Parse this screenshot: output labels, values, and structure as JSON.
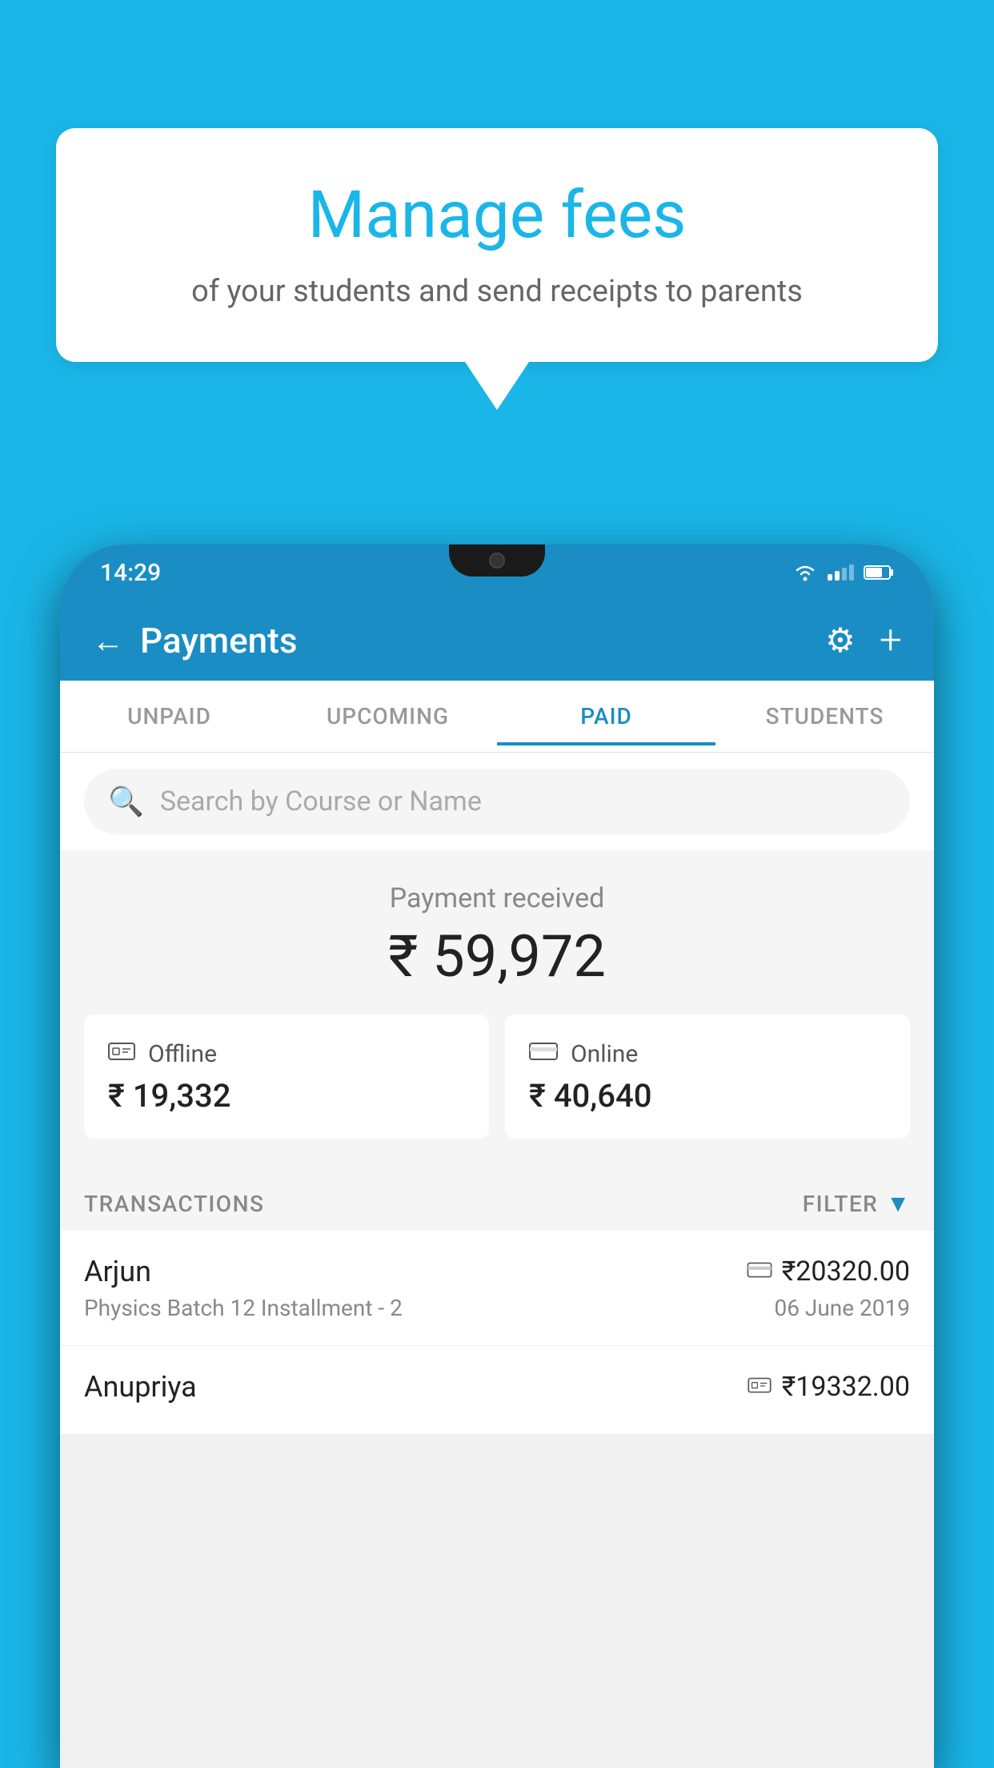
{
  "background_color": "#1ab6e8",
  "speech_bubble": {
    "title": "Manage fees",
    "subtitle": "of your students and send receipts to parents"
  },
  "status_bar": {
    "time": "14:29"
  },
  "app_bar": {
    "title": "Payments",
    "back_label": "←",
    "settings_label": "⚙",
    "add_label": "+"
  },
  "tabs": [
    {
      "label": "UNPAID",
      "active": false
    },
    {
      "label": "UPCOMING",
      "active": false
    },
    {
      "label": "PAID",
      "active": true
    },
    {
      "label": "STUDENTS",
      "active": false
    }
  ],
  "search": {
    "placeholder": "Search by Course or Name"
  },
  "payment_summary": {
    "label": "Payment received",
    "amount": "₹ 59,972",
    "offline": {
      "type": "Offline",
      "amount": "₹ 19,332"
    },
    "online": {
      "type": "Online",
      "amount": "₹ 40,640"
    }
  },
  "transactions": {
    "header": "TRANSACTIONS",
    "filter": "FILTER",
    "items": [
      {
        "name": "Arjun",
        "course": "Physics Batch 12 Installment - 2",
        "amount": "₹20320.00",
        "date": "06 June 2019",
        "payment_type": "card"
      },
      {
        "name": "Anupriya",
        "course": "",
        "amount": "₹19332.00",
        "date": "",
        "payment_type": "cash"
      }
    ]
  }
}
